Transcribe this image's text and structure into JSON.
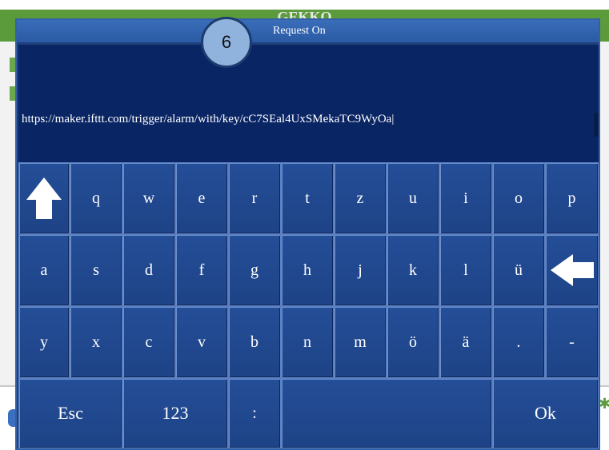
{
  "background_app": {
    "title": "GEKKO"
  },
  "dialog": {
    "title": "Request On",
    "step_badge": "6",
    "url_value": "https://maker.ifttt.com/trigger/alarm/with/key/cC7SEal4UxSMekaTC9WyOa|"
  },
  "keyboard": {
    "row1": [
      "q",
      "w",
      "e",
      "r",
      "t",
      "z",
      "u",
      "i",
      "o",
      "p"
    ],
    "row2": [
      "a",
      "s",
      "d",
      "f",
      "g",
      "h",
      "j",
      "k",
      "l",
      "ü"
    ],
    "row3": [
      "y",
      "x",
      "c",
      "v",
      "b",
      "n",
      "m",
      "ö",
      "ä",
      ".",
      "-"
    ],
    "row4": {
      "esc": "Esc",
      "numbers": "123",
      "colon": ":",
      "space": "",
      "ok": "Ok"
    },
    "icons": {
      "shift": "shift-up-arrow-icon",
      "backspace": "backspace-left-arrow-icon"
    }
  },
  "colors": {
    "dialog_bg": "#1f3f7a",
    "url_bg": "#0a2564",
    "key_bg": "#244e98",
    "header_green": "#5c9b3c",
    "badge": "#8fb3dc"
  }
}
